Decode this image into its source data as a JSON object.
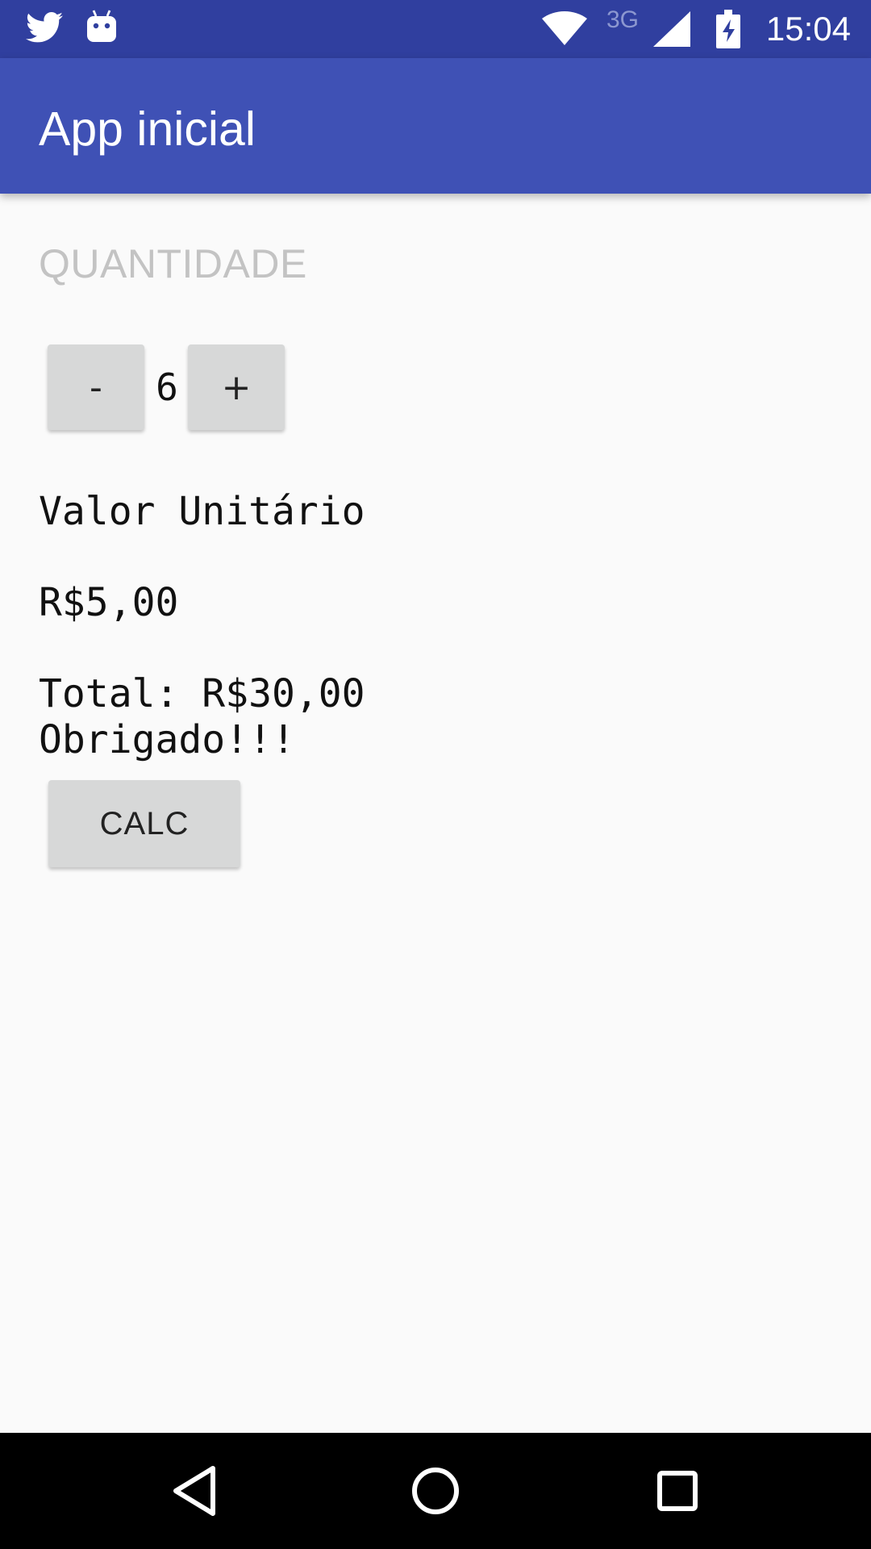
{
  "status_bar": {
    "time": "15:04",
    "network": "3G",
    "icons": [
      "twitter-icon",
      "android-icon",
      "wifi-icon",
      "signal-icon",
      "battery-charging-icon"
    ]
  },
  "app_bar": {
    "title": "App inicial"
  },
  "quantity": {
    "label": "QUANTIDADE",
    "decrement_label": "-",
    "value": "6",
    "increment_label": "+"
  },
  "price": {
    "unit_label": "Valor Unitário",
    "unit_value": "R$5,00"
  },
  "summary": {
    "total": "Total: R$30,00",
    "thanks": "Obrigado!!!"
  },
  "actions": {
    "calc_label": "CALC"
  },
  "nav_bar": {
    "icons": [
      "back-icon",
      "home-icon",
      "recents-icon"
    ]
  },
  "colors": {
    "status_bar": "#303f9f",
    "app_bar": "#3f51b5",
    "background": "#fafafa",
    "button": "#d7d8d8",
    "label_gray": "#c3c3c3"
  }
}
